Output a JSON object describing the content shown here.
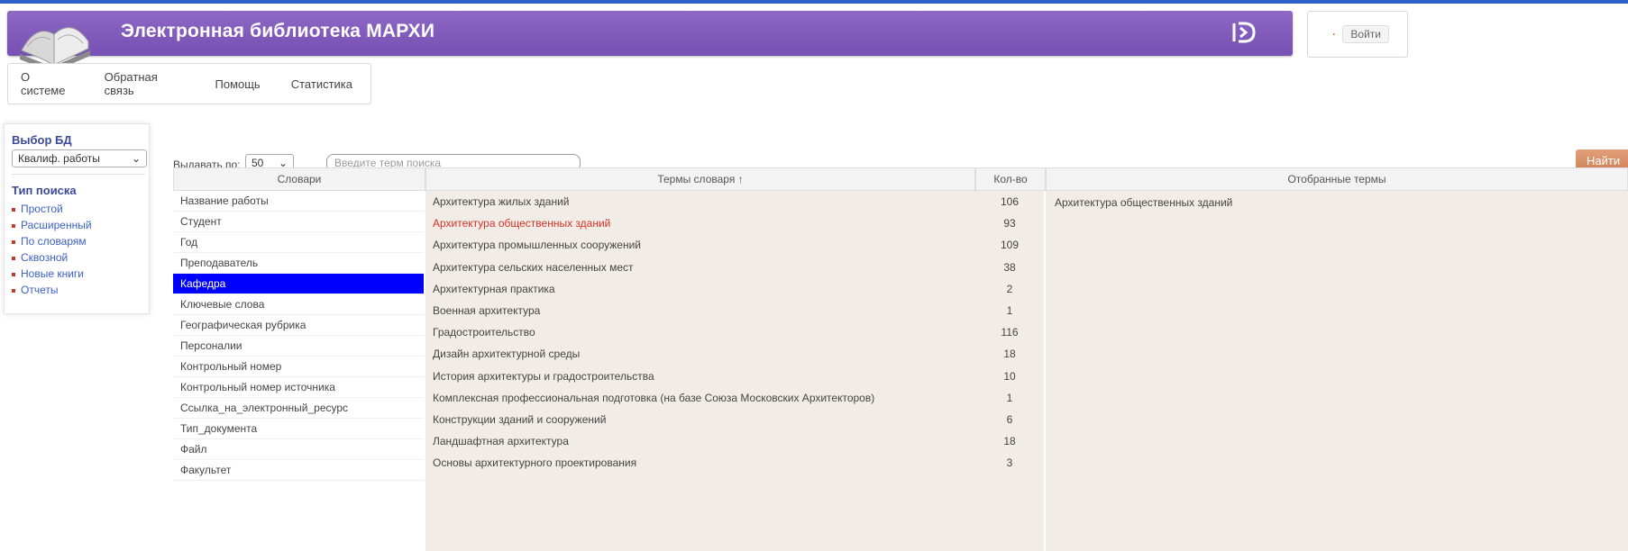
{
  "app": {
    "title": "Электронная библиотека МАРХИ",
    "brand_mark": "Ƀ",
    "login_label": "Войти",
    "accent_color": "#7d58b9"
  },
  "nav": {
    "items": [
      {
        "label": "О системе"
      },
      {
        "label": "Обратная связь"
      },
      {
        "label": "Помощь"
      },
      {
        "label": "Статистика"
      }
    ]
  },
  "left_panel": {
    "db_label": "Выбор БД",
    "db_value": "Квалиф. работы",
    "search_type_label": "Тип поиска",
    "search_types": [
      {
        "label": "Простой"
      },
      {
        "label": "Расширенный"
      },
      {
        "label": "По словарям"
      },
      {
        "label": "Сквозной"
      },
      {
        "label": "Новые книги"
      },
      {
        "label": "Отчеты"
      }
    ]
  },
  "toolbar": {
    "per_page_label": "Выдавать по:",
    "per_page_value": "50",
    "search_placeholder": "Введите терм поиска",
    "find_label": "Найти"
  },
  "table": {
    "headers": {
      "dictionaries": "Словари",
      "terms": "Термы словаря ↑",
      "count": "Кол-во",
      "selected": "Отобранные термы"
    },
    "dictionaries": [
      {
        "label": "Название работы"
      },
      {
        "label": "Студент"
      },
      {
        "label": "Год"
      },
      {
        "label": "Преподаватель"
      },
      {
        "label": "Кафедра",
        "selected": true
      },
      {
        "label": "Ключевые слова"
      },
      {
        "label": "Географическая рубрика"
      },
      {
        "label": "Персоналии"
      },
      {
        "label": "Контрольный номер"
      },
      {
        "label": "Контрольный номер источника"
      },
      {
        "label": "Ссылка_на_электронный_ресурс"
      },
      {
        "label": "Тип_документа"
      },
      {
        "label": "Файл"
      },
      {
        "label": "Факультет"
      }
    ],
    "terms": [
      {
        "name": "Архитектура жилых зданий",
        "count": "106"
      },
      {
        "name": "Архитектура общественных зданий",
        "count": "93",
        "active": true
      },
      {
        "name": "Архитектура промышленных сооружений",
        "count": "109"
      },
      {
        "name": "Архитектура сельских населенных мест",
        "count": "38"
      },
      {
        "name": "Архитектурная практика",
        "count": "2"
      },
      {
        "name": "Военная архитектура",
        "count": "1"
      },
      {
        "name": "Градостроительство",
        "count": "116"
      },
      {
        "name": "Дизайн архитектурной среды",
        "count": "18"
      },
      {
        "name": "История архитектуры и градостроительства",
        "count": "10"
      },
      {
        "name": "Комплексная профессиональная подготовка (на базе Союза Московских Архитекторов)",
        "count": "1"
      },
      {
        "name": "Конструкции зданий и сооружений",
        "count": "6"
      },
      {
        "name": "Ландшафтная архитектура",
        "count": "18"
      },
      {
        "name": "Основы архитектурного проектирования",
        "count": "3"
      }
    ],
    "selected_terms": [
      {
        "label": "Архитектура общественных зданий"
      }
    ]
  }
}
